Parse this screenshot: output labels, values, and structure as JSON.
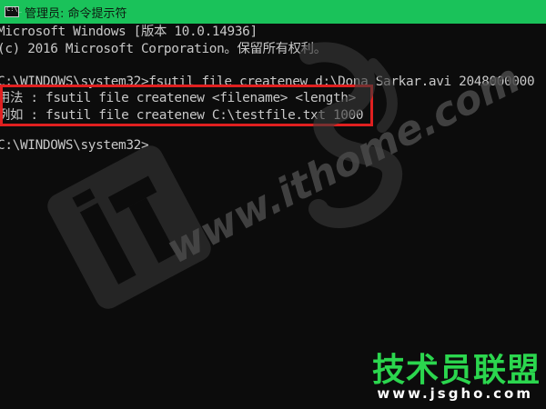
{
  "window": {
    "title": "管理员: 命令提示符",
    "icon": "cmd-icon"
  },
  "console": {
    "lines": [
      "Microsoft Windows [版本 10.0.14936]",
      "(c) 2016 Microsoft Corporation。保留所有权利。",
      "",
      "C:\\WINDOWS\\system32>fsutil file createnew d:\\Dona Sarkar.avi 2048000000",
      "用法 : fsutil file createnew <filename> <length>",
      "例如 : fsutil file createnew C:\\testfile.txt 1000",
      "",
      "C:\\WINDOWS\\system32>"
    ]
  },
  "watermark": {
    "site": "www.ithome.com",
    "brand": "技术员联盟",
    "url": "www.jsgho.com"
  },
  "colors": {
    "titlebar": "#1ac25a",
    "console_bg": "#0c0c0c",
    "console_text": "#c8c8c8",
    "highlight": "#e02020",
    "brand_green": "#2bd64e"
  }
}
